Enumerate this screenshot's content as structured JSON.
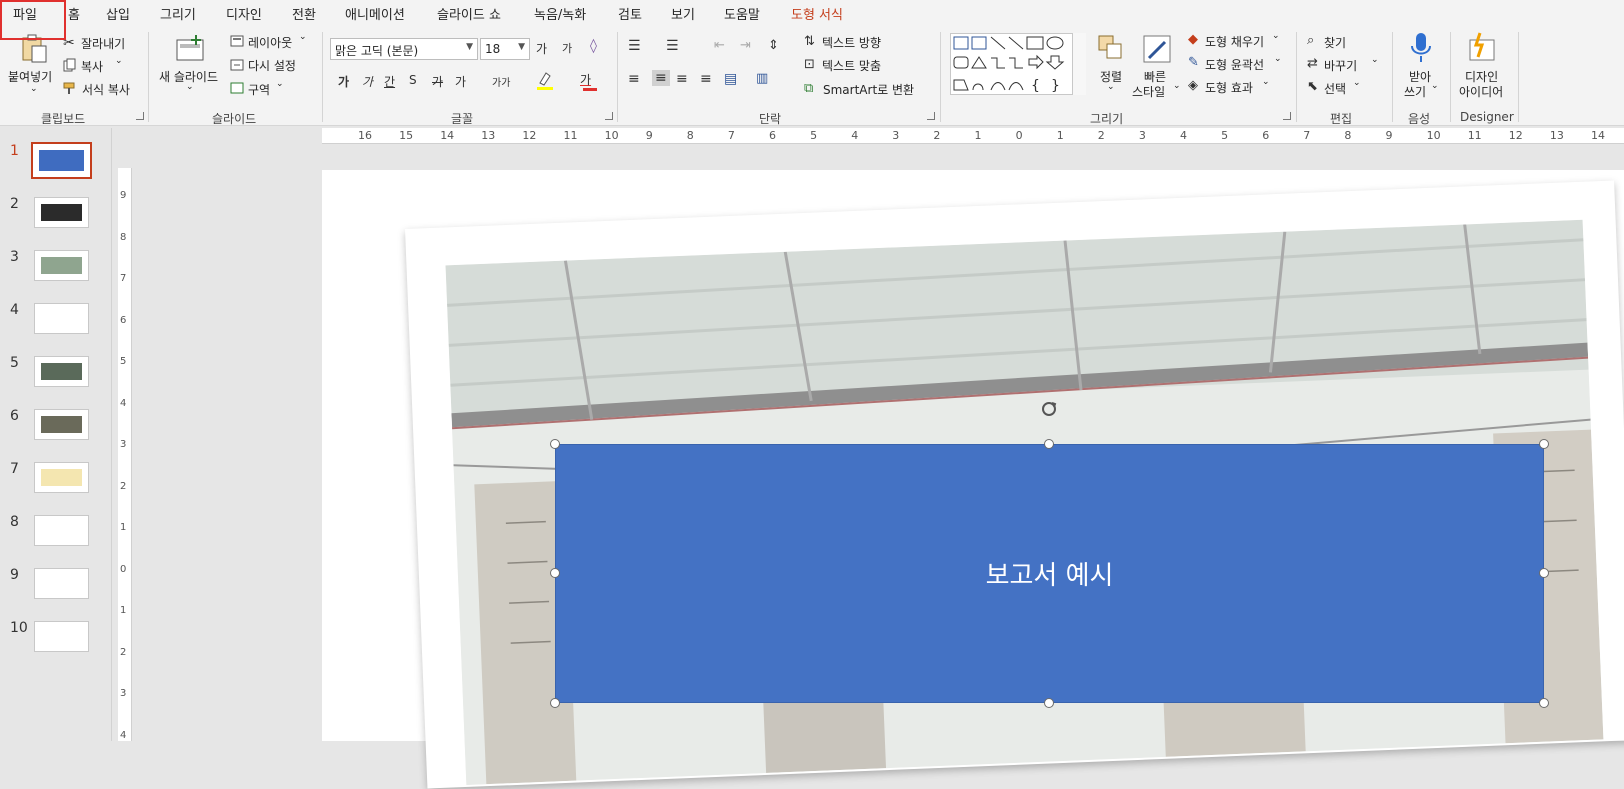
{
  "tabs": [
    "파일",
    "홈",
    "삽입",
    "그리기",
    "디자인",
    "전환",
    "애니메이션",
    "슬라이드 쇼",
    "녹음/녹화",
    "검토",
    "보기",
    "도움말",
    "도형 서식"
  ],
  "clipboard": {
    "paste": "붙여넣기",
    "cut": "잘라내기",
    "copy": "복사",
    "format_painter": "서식 복사",
    "group": "클립보드"
  },
  "slides_group": {
    "new_slide": "새 슬라이드",
    "layout": "레이아웃",
    "reset": "다시 설정",
    "section": "구역",
    "group": "슬라이드"
  },
  "font": {
    "name": "맑은 고딕 (본문)",
    "size": "18",
    "grow": "가",
    "shrink": "가",
    "bold": "가",
    "italic": "가",
    "underline": "간",
    "shadow": "S",
    "strike": "가",
    "spacing": "가",
    "case": "가가",
    "font_color": "가",
    "group": "글꼴"
  },
  "paragraph": {
    "text_direction": "텍스트 방향",
    "align_text": "텍스트 맞춤",
    "smartart": "SmartArt로 변환",
    "group": "단락"
  },
  "drawing": {
    "arrange": "정렬",
    "quick_styles_1": "빠른",
    "quick_styles_2": "스타일",
    "fill": "도형 채우기",
    "outline": "도형 윤곽선",
    "effects": "도형 효과",
    "group": "그리기"
  },
  "editing": {
    "find": "찾기",
    "replace": "바꾸기",
    "select": "선택",
    "group": "편집"
  },
  "voice": {
    "dictate_1": "받아",
    "dictate_2": "쓰기",
    "group": "음성"
  },
  "designer": {
    "ideas_1": "디자인",
    "ideas_2": "아이디어",
    "group": "Designer"
  },
  "ruler_h": [
    "16",
    "15",
    "14",
    "13",
    "12",
    "11",
    "10",
    "9",
    "8",
    "7",
    "6",
    "5",
    "4",
    "3",
    "2",
    "1",
    "0",
    "1",
    "2",
    "3",
    "4",
    "5",
    "6",
    "7",
    "8",
    "9",
    "10",
    "11",
    "12",
    "13",
    "14"
  ],
  "ruler_v": [
    "9",
    "8",
    "7",
    "6",
    "5",
    "4",
    "3",
    "2",
    "1",
    "0",
    "1",
    "2",
    "3",
    "4"
  ],
  "slides": [
    "1",
    "2",
    "3",
    "4",
    "5",
    "6",
    "7",
    "8",
    "9",
    "10"
  ],
  "active_slide": "1",
  "slide": {
    "title": "보고서 예시"
  },
  "colors": {
    "accent": "#c43e1c",
    "shape_fill": "#4472c4",
    "highlight": "#e0302e"
  }
}
